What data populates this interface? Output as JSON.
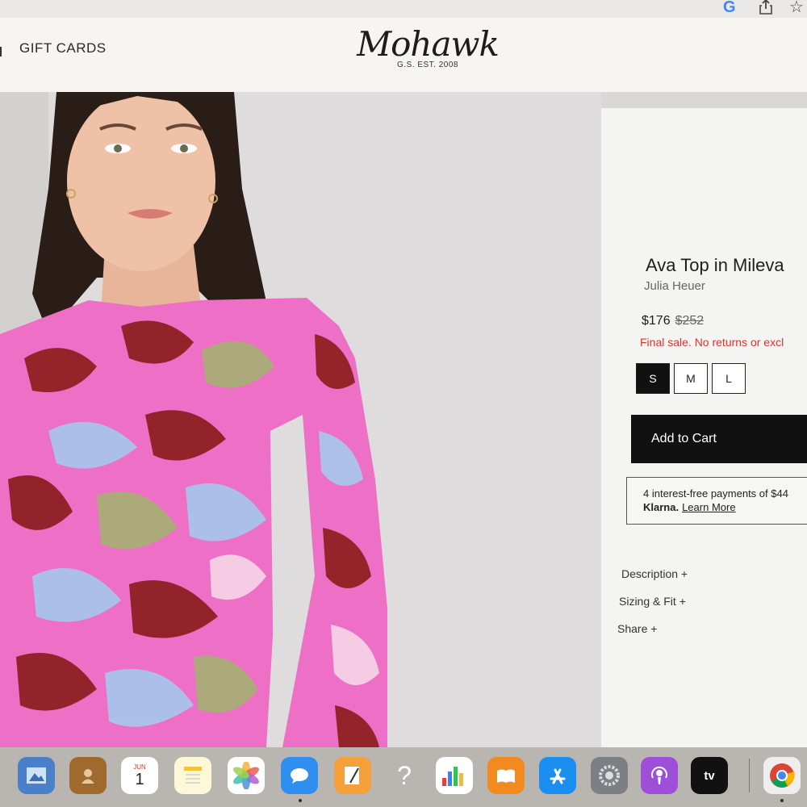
{
  "browser": {
    "icons": [
      "google-g-icon",
      "share-icon",
      "bookmark-star-icon"
    ],
    "google_glyph": "G",
    "star_glyph": "☆"
  },
  "header": {
    "nav_link": "GIFT CARDS",
    "logo_text": "Mohawk",
    "logo_subtitle": "G.S. EST. 2008"
  },
  "product": {
    "title": "Ava Top in Mileva",
    "brand": "Julia Heuer",
    "price": "$176",
    "original_price": "$252",
    "sale_notice": "Final sale. No returns or excl",
    "sizes": [
      "S",
      "M",
      "L"
    ],
    "selected_size": "S",
    "add_to_cart_label": "Add to Cart",
    "klarna_text": "4 interest-free payments of $44",
    "klarna_brand": "Klarna.",
    "klarna_link": "Learn More",
    "accordions": [
      "Description +",
      "Sizing & Fit +",
      "Share +"
    ]
  },
  "dock": {
    "apps": [
      "preview-icon",
      "contacts-icon",
      "calendar-icon",
      "notes-icon",
      "photos-icon",
      "messages-icon",
      "pages-icon",
      "unknown-app-icon",
      "numbers-icon",
      "books-icon",
      "app-store-icon",
      "system-preferences-icon",
      "podcasts-icon",
      "apple-tv-icon",
      "chrome-icon"
    ],
    "calendar_month": "JUN",
    "calendar_day": "1",
    "unknown_glyph": "?",
    "tv_label": "tv"
  },
  "colors": {
    "accent_sale": "#d8352c",
    "button_bg": "#111111",
    "print_pink": "#ee6fc6",
    "print_maroon": "#8e1f22",
    "print_olive": "#a9ad76",
    "print_blue": "#a9c4ec"
  }
}
